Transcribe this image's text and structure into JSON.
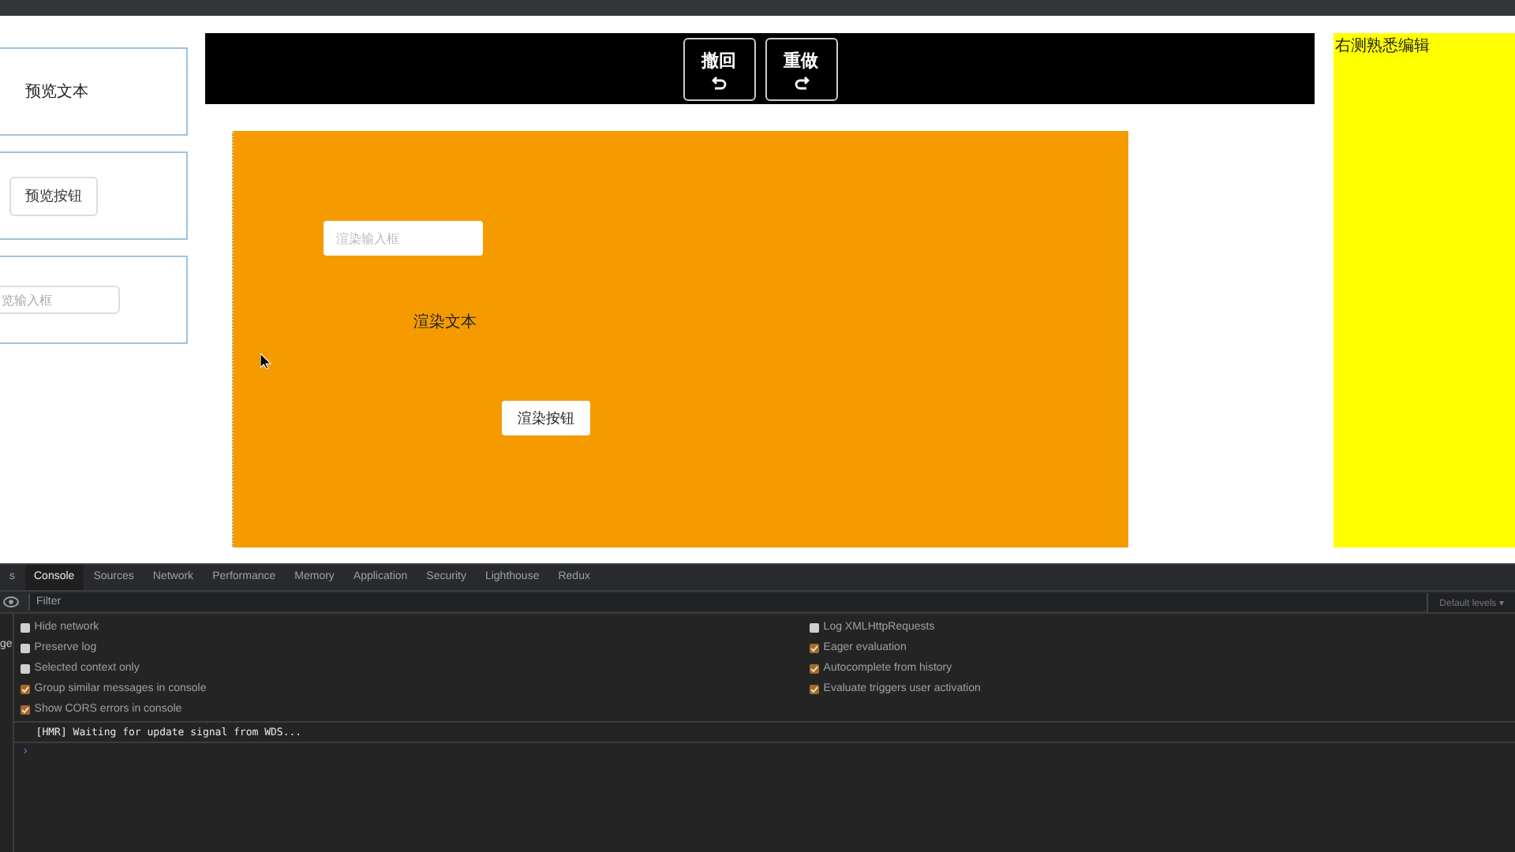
{
  "preview_panel": {
    "items": [
      {
        "kind": "text",
        "text": "预览文本"
      },
      {
        "kind": "button",
        "text": "预览按钮"
      },
      {
        "kind": "input",
        "placeholder": "览输入框"
      }
    ]
  },
  "toolbar": {
    "buttons": [
      {
        "label": "撤回"
      },
      {
        "label": "重做"
      }
    ]
  },
  "canvas": {
    "items": [
      {
        "kind": "input",
        "placeholder": "渲染输入框"
      },
      {
        "kind": "text",
        "text": "渲染文本"
      },
      {
        "kind": "button",
        "text": "渲染按钮"
      }
    ]
  },
  "right_panel": {
    "title": "右测熟悉编辑"
  },
  "devtools": {
    "tabs": [
      {
        "label": "s",
        "selected": false
      },
      {
        "label": "Console",
        "selected": true
      },
      {
        "label": "Sources",
        "selected": false
      },
      {
        "label": "Network",
        "selected": false
      },
      {
        "label": "Performance",
        "selected": false
      },
      {
        "label": "Memory",
        "selected": false
      },
      {
        "label": "Application",
        "selected": false
      },
      {
        "label": "Security",
        "selected": false
      },
      {
        "label": "Lighthouse",
        "selected": false
      },
      {
        "label": "Redux",
        "selected": false
      }
    ],
    "filter": {
      "placeholder": "Filter"
    },
    "levels": "Default levels ▾",
    "sidebar": {
      "items": [
        "ge"
      ]
    },
    "settings_left": [
      {
        "label": "Hide network",
        "checked": false
      },
      {
        "label": "Preserve log",
        "checked": false
      },
      {
        "label": "Selected context only",
        "checked": false
      },
      {
        "label": "Group similar messages in console",
        "checked": true
      },
      {
        "label": "Show CORS errors in console",
        "checked": true
      }
    ],
    "settings_right": [
      {
        "label": "Log XMLHttpRequests",
        "checked": false
      },
      {
        "label": "Eager evaluation",
        "checked": true
      },
      {
        "label": "Autocomplete from history",
        "checked": true
      },
      {
        "label": "Evaluate triggers user activation",
        "checked": true
      }
    ],
    "messages": [
      "[HMR] Waiting for update signal from WDS..."
    ],
    "prompt": "›"
  }
}
